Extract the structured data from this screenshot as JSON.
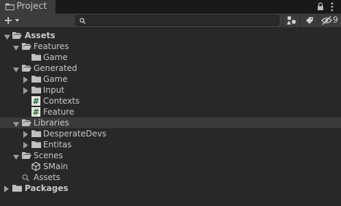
{
  "tab": {
    "title": "Project",
    "icon": "folder-icon"
  },
  "tabbar_icons": [
    "lock-icon",
    "more-menu-icon"
  ],
  "toolbar": {
    "create_icon": "plus-icon",
    "search": {
      "value": "",
      "placeholder": ""
    },
    "buttons": [
      "filter-by-type-icon",
      "filter-by-label-icon",
      "hidden-packages-icon"
    ],
    "hidden_count": "9"
  },
  "tree": [
    {
      "label": "Assets",
      "bold": true,
      "expanded": true,
      "arrow": true,
      "icon": "folder-open-icon"
    },
    {
      "label": "Features",
      "expanded": true,
      "arrow": true,
      "icon": "folder-open-icon"
    },
    {
      "label": "Game",
      "arrow": false,
      "icon": "folder-icon"
    },
    {
      "label": "Generated",
      "expanded": true,
      "arrow": true,
      "icon": "folder-open-icon"
    },
    {
      "label": "Game",
      "expanded": false,
      "arrow": true,
      "icon": "folder-icon"
    },
    {
      "label": "Input",
      "expanded": false,
      "arrow": true,
      "icon": "folder-icon"
    },
    {
      "label": "Contexts",
      "arrow": false,
      "icon": "csharp-script-icon"
    },
    {
      "label": "Feature",
      "arrow": false,
      "icon": "csharp-script-icon"
    },
    {
      "label": "Libraries",
      "expanded": true,
      "arrow": true,
      "icon": "folder-open-icon",
      "selected": true
    },
    {
      "label": "DesperateDevs",
      "expanded": false,
      "arrow": true,
      "icon": "folder-icon"
    },
    {
      "label": "Entitas",
      "expanded": false,
      "arrow": true,
      "icon": "folder-icon"
    },
    {
      "label": "Scenes",
      "expanded": true,
      "arrow": true,
      "icon": "folder-open-icon"
    },
    {
      "label": "SMain",
      "arrow": false,
      "icon": "unity-scene-icon"
    },
    {
      "label": "Assets",
      "arrow": false,
      "icon": "search-icon"
    },
    {
      "label": "Packages",
      "bold": true,
      "expanded": false,
      "arrow": true,
      "icon": "folder-icon"
    }
  ],
  "colors": {
    "background": "#282828",
    "toolbar": "#3c3c3c",
    "selected_row": "#3a3a3a",
    "script_green": "#1f6b2e"
  }
}
